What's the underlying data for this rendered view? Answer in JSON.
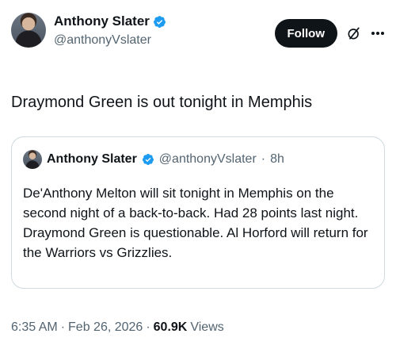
{
  "author": {
    "name": "Anthony Slater",
    "handle": "@anthonyVslater"
  },
  "actions": {
    "follow_label": "Follow"
  },
  "tweet": {
    "text": "Draymond Green is out tonight in Memphis"
  },
  "quoted": {
    "name": "Anthony Slater",
    "handle": "@anthonyVslater",
    "separator": "·",
    "time": "8h",
    "text": "De'Anthony Melton will sit tonight in Memphis on the second night of a back-to-back. Had 28 points last night. Draymond Green is questionable. Al Horford will return for the Warriors vs Grizzlies."
  },
  "meta": {
    "time": "6:35 AM",
    "sep1": "·",
    "date": "Feb 26, 2026",
    "sep2": "·",
    "views_count": "60.9K",
    "views_label": "Views"
  },
  "colors": {
    "verified_blue": "#1d9bf0",
    "text_primary": "#0f1419",
    "text_secondary": "#536471",
    "border": "#cfd9de"
  },
  "icons": [
    "verified-badge-icon",
    "grok-icon",
    "more-icon"
  ]
}
